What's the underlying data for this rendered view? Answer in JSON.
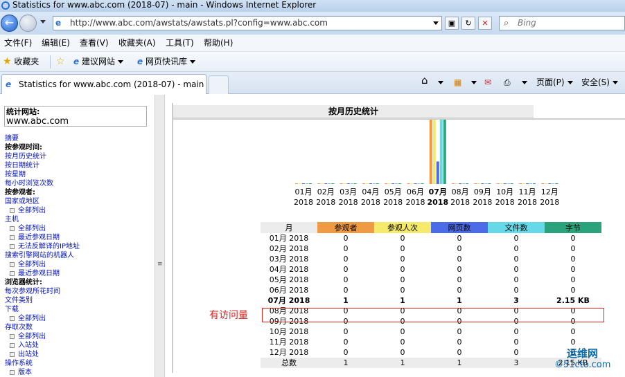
{
  "window": {
    "title": "Statistics for www.abc.com (2018-07) - main - Windows Internet Explorer"
  },
  "address": {
    "url": "http://www.abc.com/awstats/awstats.pl?config=www.abc.com"
  },
  "search": {
    "placeholder": "Bing"
  },
  "menu": [
    "文件(F)",
    "编辑(E)",
    "查看(V)",
    "收藏夹(A)",
    "工具(T)",
    "帮助(H)"
  ],
  "favorites": {
    "label": "收藏夹",
    "links": [
      "建议网站",
      "网页快讯库"
    ]
  },
  "tab": {
    "title": "Statistics for www.abc.com (2018-07) - main"
  },
  "commandbar": {
    "page": "页面(P)",
    "safety": "安全(S)"
  },
  "sidebar": {
    "site_label": "统计网站:",
    "site_value": "www.abc.com",
    "items": [
      {
        "text": "摘要",
        "kind": "link"
      },
      {
        "text": "按参观时间:",
        "kind": "heading"
      },
      {
        "text": "按月历史统计",
        "kind": "link"
      },
      {
        "text": "按日期统计",
        "kind": "link"
      },
      {
        "text": "按星期",
        "kind": "link"
      },
      {
        "text": "每小时浏览次数",
        "kind": "link"
      },
      {
        "text": "按参观者:",
        "kind": "heading"
      },
      {
        "text": "国家或地区",
        "kind": "link"
      },
      {
        "text": "全部列出",
        "kind": "sub"
      },
      {
        "text": "主机",
        "kind": "link"
      },
      {
        "text": "全部列出",
        "kind": "sub"
      },
      {
        "text": "最近参观日期",
        "kind": "sub"
      },
      {
        "text": "无法反解译的IP地址",
        "kind": "sub"
      },
      {
        "text": "搜索引擎网站的机器人",
        "kind": "link"
      },
      {
        "text": "全部列出",
        "kind": "sub"
      },
      {
        "text": "最近参观日期",
        "kind": "sub"
      },
      {
        "text": "浏览器统计:",
        "kind": "heading"
      },
      {
        "text": "每次参观所花时间",
        "kind": "link"
      },
      {
        "text": "文件类别",
        "kind": "link"
      },
      {
        "text": "下载",
        "kind": "link"
      },
      {
        "text": "全部列出",
        "kind": "sub"
      },
      {
        "text": "存取次数",
        "kind": "link"
      },
      {
        "text": "全部列出",
        "kind": "sub"
      },
      {
        "text": "入站处",
        "kind": "sub"
      },
      {
        "text": "出站处",
        "kind": "sub"
      },
      {
        "text": "操作系统",
        "kind": "link"
      },
      {
        "text": "版本",
        "kind": "sub"
      }
    ]
  },
  "panel": {
    "title": "按月历史统计"
  },
  "chart_data": {
    "type": "bar",
    "categories": [
      "01月 2018",
      "02月 2018",
      "03月 2018",
      "04月 2018",
      "05月 2018",
      "06月 2018",
      "07月 2018",
      "08月 2018",
      "09月 2018",
      "10月 2018",
      "11月 2018",
      "12月 2018"
    ],
    "month_labels": [
      "01月",
      "02月",
      "03月",
      "04月",
      "05月",
      "06月",
      "07月",
      "08月",
      "09月",
      "10月",
      "11月",
      "12月"
    ],
    "year_label": "2018",
    "current_month_index": 6,
    "series": [
      {
        "name": "参观者",
        "color": "#ee9b44",
        "values": [
          0,
          0,
          0,
          0,
          0,
          0,
          1,
          0,
          0,
          0,
          0,
          0
        ]
      },
      {
        "name": "参观人次",
        "color": "#f6ea6c",
        "values": [
          0,
          0,
          0,
          0,
          0,
          0,
          1,
          0,
          0,
          0,
          0,
          0
        ]
      },
      {
        "name": "网页数",
        "color": "#4b6ce6",
        "values": [
          0,
          0,
          0,
          0,
          0,
          0,
          1,
          0,
          0,
          0,
          0,
          0
        ]
      },
      {
        "name": "文件数",
        "color": "#66d9e8",
        "values": [
          0,
          0,
          0,
          0,
          0,
          0,
          3,
          0,
          0,
          0,
          0,
          0
        ]
      },
      {
        "name": "字节",
        "color": "#2aa37d",
        "values": [
          0,
          0,
          0,
          0,
          0,
          0,
          2.15,
          0,
          0,
          0,
          0,
          0
        ]
      }
    ]
  },
  "table": {
    "headers": [
      "月",
      "参观者",
      "参观人次",
      "网页数",
      "文件数",
      "字节"
    ],
    "header_colors": [
      "#ececec",
      "#ee9b44",
      "#f6ea6c",
      "#4b6ce6",
      "#66d9e8",
      "#2aa37d"
    ],
    "rows": [
      [
        "01月 2018",
        "0",
        "0",
        "0",
        "0",
        "0"
      ],
      [
        "02月 2018",
        "0",
        "0",
        "0",
        "0",
        "0"
      ],
      [
        "03月 2018",
        "0",
        "0",
        "0",
        "0",
        "0"
      ],
      [
        "04月 2018",
        "0",
        "0",
        "0",
        "0",
        "0"
      ],
      [
        "05月 2018",
        "0",
        "0",
        "0",
        "0",
        "0"
      ],
      [
        "06月 2018",
        "0",
        "0",
        "0",
        "0",
        "0"
      ],
      [
        "07月 2018",
        "1",
        "1",
        "1",
        "3",
        "2.15 KB"
      ],
      [
        "08月 2018",
        "0",
        "0",
        "0",
        "0",
        "0"
      ],
      [
        "09月 2018",
        "0",
        "0",
        "0",
        "0",
        "0"
      ],
      [
        "10月 2018",
        "0",
        "0",
        "0",
        "0",
        "0"
      ],
      [
        "11月 2018",
        "0",
        "0",
        "0",
        "0",
        "0"
      ],
      [
        "12月 2018",
        "0",
        "0",
        "0",
        "0",
        "0"
      ]
    ],
    "total": [
      "总数",
      "1",
      "1",
      "1",
      "3",
      "2.15 KB"
    ]
  },
  "annotation": {
    "text": "有访问量"
  },
  "watermark": {
    "line1": "运维网",
    "line2": "©51cto.com"
  }
}
